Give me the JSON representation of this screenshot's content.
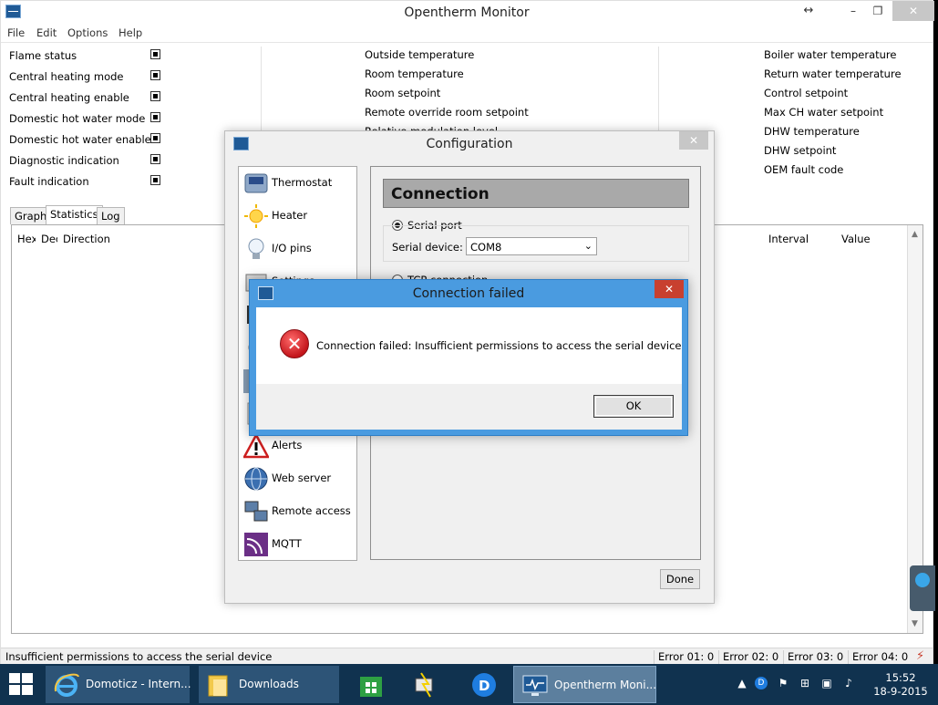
{
  "window": {
    "title": "Opentherm Monitor",
    "arrows_glyph": "↔",
    "minimize_glyph": "–",
    "maximize_glyph": "❐",
    "close_glyph": "✕"
  },
  "menu": [
    "File",
    "Edit",
    "Options",
    "Help"
  ],
  "status_flags": [
    "Flame status",
    "Central heating mode",
    "Central heating enable",
    "Domestic hot water mode",
    "Domestic hot water enable",
    "Diagnostic indication",
    "Fault indication"
  ],
  "middle_column": [
    "Outside temperature",
    "Room temperature",
    "Room setpoint",
    "Remote override room setpoint",
    "Relative modulation level"
  ],
  "right_column": [
    "Boiler water temperature",
    "Return water temperature",
    "Control setpoint",
    "Max CH water setpoint",
    "DHW temperature",
    "DHW setpoint",
    "OEM fault code"
  ],
  "tabs": [
    "Graph",
    "Statistics",
    "Log"
  ],
  "active_tab": "Statistics",
  "table_columns": [
    "Hex",
    "Dec",
    "Direction",
    "Interval",
    "Value"
  ],
  "statusbar": {
    "message": "Insufficient permissions to access the serial device",
    "errors": [
      "Error 01:  0",
      "Error 02:  0",
      "Error 03:  0",
      "Error 04:  0"
    ]
  },
  "config": {
    "title": "Configuration",
    "close_glyph": "✕",
    "items": [
      "Thermostat",
      "Heater",
      "I/O pins",
      "Settings",
      "",
      "",
      "",
      "",
      "Alerts",
      "Web server",
      "Remote access",
      "MQTT"
    ],
    "section_title": "Connection",
    "serial_label": "Serial port",
    "serial_device_label": "Serial device:",
    "serial_device_value": "COM8",
    "tcp_label": "TCP connection",
    "done_label": "Done"
  },
  "error_dialog": {
    "title": "Connection failed",
    "message": "Connection failed: Insufficient permissions to access the serial device",
    "ok_label": "OK",
    "close_glyph": "✕"
  },
  "taskbar": {
    "apps": [
      {
        "label": "Domoticz - Intern..."
      },
      {
        "label": "Downloads"
      },
      {
        "label": "Opentherm Moni..."
      }
    ],
    "time": "15:52",
    "date": "18-9-2015"
  },
  "colors": {
    "taskbar": "#10324f",
    "error_titlebar": "#4a9be0",
    "close_red": "#c8402f"
  }
}
